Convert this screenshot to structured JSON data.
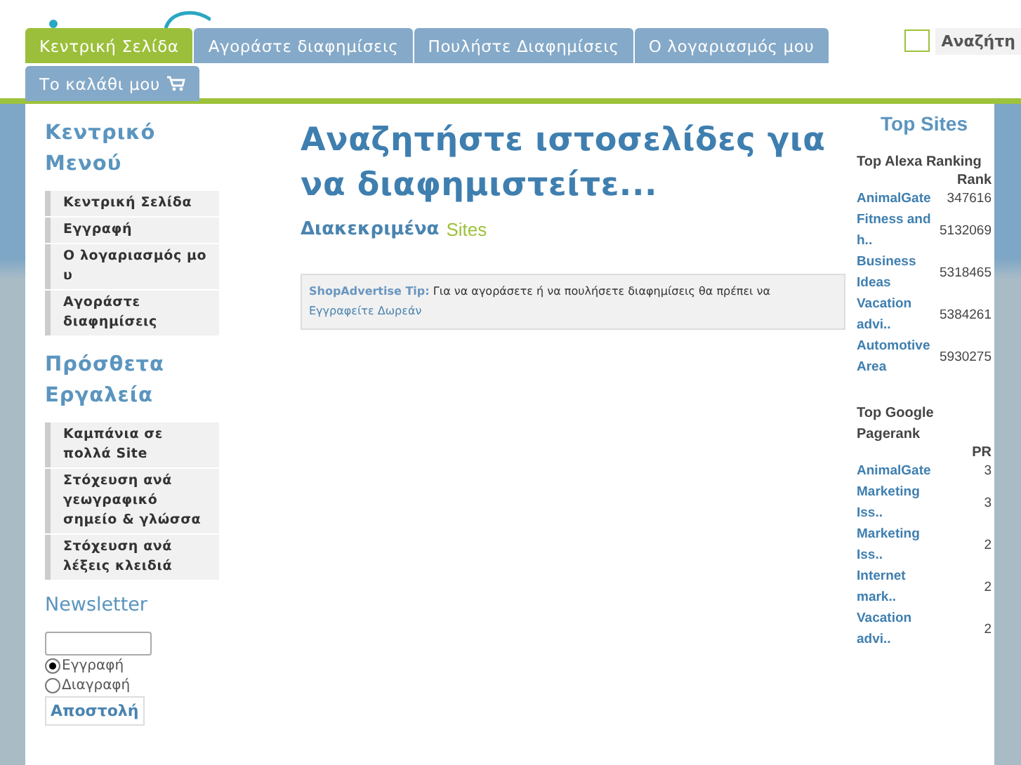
{
  "nav": {
    "tabs": [
      {
        "label": "Κεντρική Σελίδα",
        "selected": true
      },
      {
        "label": "Αγοράστε διαφημίσεις",
        "selected": false
      },
      {
        "label": "Πουλήστε Διαφημίσεις",
        "selected": false
      },
      {
        "label": "Ο λογαριασμός μου",
        "selected": false
      },
      {
        "label": "Το καλάθι μου",
        "selected": false,
        "cart": true
      }
    ],
    "search_button": "Αναζήτη"
  },
  "sidebar": {
    "sections": [
      {
        "title": "Κεντρικό Μενού",
        "items": [
          "Κεντρική Σελίδα",
          "Εγγραφή",
          "Ο λογαριασμός μο υ",
          "Αγοράστε διαφημίσεις"
        ]
      },
      {
        "title": "Πρόσθετα Εργαλεία",
        "items": [
          "Καμπάνια σε πολλά Site",
          "Στόχευση ανά γεωγραφικό σημείο & γλώσσα",
          "Στόχευση ανά λέξεις κλειδιά"
        ]
      }
    ],
    "newsletter": {
      "title": "Newsletter",
      "options": [
        {
          "label": "Εγγραφή",
          "selected": true
        },
        {
          "label": "Διαγραφή",
          "selected": false
        }
      ],
      "submit": "Αποστολή"
    }
  },
  "main": {
    "title": "Αναζητήστε ιστοσελίδες για να διαφημιστείτε...",
    "subtitle": "Διακεκριμένα",
    "subtitle_accent": "Sites",
    "tip": {
      "label": "ShopAdvertise Tip:",
      "text": "Για να αγοράσετε ή να πουλήσετε διαφημίσεις θα πρέπει να",
      "link": "Εγγραφείτε Δωρεάν"
    }
  },
  "top_sites": {
    "title": "Top Sites",
    "tables": [
      {
        "heading": "Top Alexa Ranking",
        "column": "Rank",
        "rows": [
          {
            "site": "AnimalGate",
            "value": "347616"
          },
          {
            "site": "Fitness and h..",
            "value": "5132069"
          },
          {
            "site": "Business Ideas",
            "value": "5318465"
          },
          {
            "site": "Vacation advi..",
            "value": "5384261"
          },
          {
            "site": "Automotive Area",
            "value": "5930275"
          }
        ]
      },
      {
        "heading": "Top Google Pagerank",
        "column": "PR",
        "rows": [
          {
            "site": "AnimalGate",
            "value": "3"
          },
          {
            "site": "Marketing Iss..",
            "value": "3"
          },
          {
            "site": "Marketing Iss..",
            "value": "2"
          },
          {
            "site": "Internet mark..",
            "value": "2"
          },
          {
            "site": "Vacation advi..",
            "value": "2"
          }
        ]
      }
    ]
  }
}
